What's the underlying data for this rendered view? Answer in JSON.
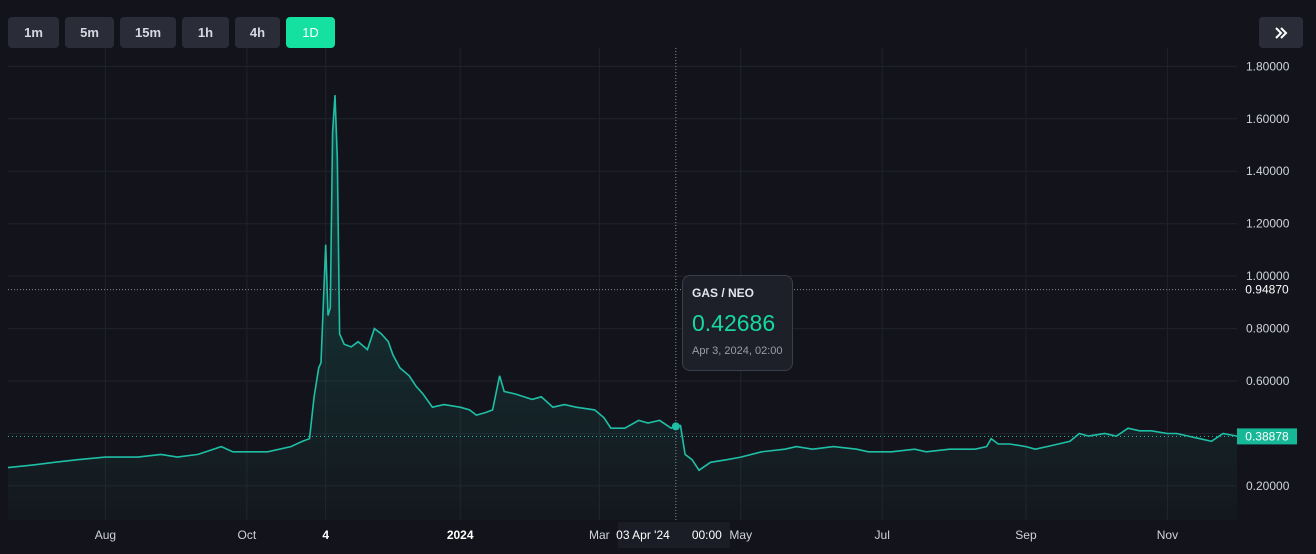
{
  "toolbar": {
    "timeframes": [
      "1m",
      "5m",
      "15m",
      "1h",
      "4h",
      "1D"
    ],
    "active": "1D"
  },
  "tooltip": {
    "pair": "GAS / NEO",
    "price": "0.42686",
    "date": "Apr 3, 2024, 02:00"
  },
  "crosshair": {
    "x_label": "03 Apr '24",
    "x_time": "00:00",
    "y_label": "0.94870"
  },
  "colors": {
    "line": "#1fbfa6",
    "accent": "#14e0a0",
    "background": "#13141b"
  },
  "chart_data": {
    "type": "area",
    "pair": "GAS / NEO",
    "last_value": 0.38878,
    "y_ticks": [
      "0.20000",
      "0.40000",
      "0.60000",
      "0.80000",
      "1.00000",
      "1.20000",
      "1.40000",
      "1.60000",
      "1.80000"
    ],
    "x_ticks": [
      {
        "label": "Aug",
        "date": "2023-08-01"
      },
      {
        "label": "Oct",
        "date": "2023-10-01"
      },
      {
        "label": "4",
        "date": "2023-11-04"
      },
      {
        "label": "2024",
        "date": "2024-01-01"
      },
      {
        "label": "Mar",
        "date": "2024-03-01"
      },
      {
        "label": "May",
        "date": "2024-05-01"
      },
      {
        "label": "Jul",
        "date": "2024-07-01"
      },
      {
        "label": "Sep",
        "date": "2024-09-01"
      },
      {
        "label": "Nov",
        "date": "2024-11-01"
      }
    ],
    "ylim": [
      0.07,
      1.87
    ],
    "xlim": [
      "2023-06-20",
      "2024-12-01"
    ],
    "series": [
      {
        "points": [
          [
            "2023-06-20",
            0.27
          ],
          [
            "2023-07-01",
            0.28
          ],
          [
            "2023-07-10",
            0.29
          ],
          [
            "2023-07-20",
            0.3
          ],
          [
            "2023-08-01",
            0.31
          ],
          [
            "2023-08-15",
            0.31
          ],
          [
            "2023-08-25",
            0.32
          ],
          [
            "2023-09-01",
            0.31
          ],
          [
            "2023-09-10",
            0.32
          ],
          [
            "2023-09-20",
            0.35
          ],
          [
            "2023-09-25",
            0.33
          ],
          [
            "2023-10-01",
            0.33
          ],
          [
            "2023-10-10",
            0.33
          ],
          [
            "2023-10-20",
            0.35
          ],
          [
            "2023-10-25",
            0.37
          ],
          [
            "2023-10-28",
            0.38
          ],
          [
            "2023-10-30",
            0.54
          ],
          [
            "2023-11-01",
            0.65
          ],
          [
            "2023-11-02",
            0.67
          ],
          [
            "2023-11-03",
            0.9
          ],
          [
            "2023-11-04",
            1.12
          ],
          [
            "2023-11-05",
            0.85
          ],
          [
            "2023-11-06",
            0.88
          ],
          [
            "2023-11-07",
            1.55
          ],
          [
            "2023-11-08",
            1.69
          ],
          [
            "2023-11-09",
            1.45
          ],
          [
            "2023-11-10",
            0.78
          ],
          [
            "2023-11-12",
            0.74
          ],
          [
            "2023-11-15",
            0.73
          ],
          [
            "2023-11-18",
            0.75
          ],
          [
            "2023-11-22",
            0.72
          ],
          [
            "2023-11-25",
            0.8
          ],
          [
            "2023-11-28",
            0.78
          ],
          [
            "2023-12-01",
            0.75
          ],
          [
            "2023-12-03",
            0.7
          ],
          [
            "2023-12-06",
            0.65
          ],
          [
            "2023-12-10",
            0.62
          ],
          [
            "2023-12-13",
            0.58
          ],
          [
            "2023-12-16",
            0.55
          ],
          [
            "2023-12-20",
            0.5
          ],
          [
            "2023-12-25",
            0.51
          ],
          [
            "2024-01-01",
            0.5
          ],
          [
            "2024-01-05",
            0.49
          ],
          [
            "2024-01-08",
            0.47
          ],
          [
            "2024-01-12",
            0.48
          ],
          [
            "2024-01-15",
            0.49
          ],
          [
            "2024-01-18",
            0.62
          ],
          [
            "2024-01-20",
            0.56
          ],
          [
            "2024-01-25",
            0.55
          ],
          [
            "2024-02-01",
            0.53
          ],
          [
            "2024-02-05",
            0.54
          ],
          [
            "2024-02-10",
            0.5
          ],
          [
            "2024-02-15",
            0.51
          ],
          [
            "2024-02-20",
            0.5
          ],
          [
            "2024-02-28",
            0.49
          ],
          [
            "2024-03-03",
            0.46
          ],
          [
            "2024-03-06",
            0.42
          ],
          [
            "2024-03-12",
            0.42
          ],
          [
            "2024-03-18",
            0.45
          ],
          [
            "2024-03-22",
            0.44
          ],
          [
            "2024-03-27",
            0.45
          ],
          [
            "2024-04-01",
            0.42
          ],
          [
            "2024-04-03",
            0.43
          ],
          [
            "2024-04-05",
            0.43
          ],
          [
            "2024-04-07",
            0.32
          ],
          [
            "2024-04-10",
            0.3
          ],
          [
            "2024-04-13",
            0.26
          ],
          [
            "2024-04-18",
            0.29
          ],
          [
            "2024-04-25",
            0.3
          ],
          [
            "2024-05-01",
            0.31
          ],
          [
            "2024-05-10",
            0.33
          ],
          [
            "2024-05-20",
            0.34
          ],
          [
            "2024-05-25",
            0.35
          ],
          [
            "2024-06-01",
            0.34
          ],
          [
            "2024-06-10",
            0.35
          ],
          [
            "2024-06-20",
            0.34
          ],
          [
            "2024-06-25",
            0.33
          ],
          [
            "2024-07-05",
            0.33
          ],
          [
            "2024-07-15",
            0.34
          ],
          [
            "2024-07-20",
            0.33
          ],
          [
            "2024-07-30",
            0.34
          ],
          [
            "2024-08-10",
            0.34
          ],
          [
            "2024-08-15",
            0.35
          ],
          [
            "2024-08-17",
            0.38
          ],
          [
            "2024-08-20",
            0.36
          ],
          [
            "2024-08-25",
            0.36
          ],
          [
            "2024-09-01",
            0.35
          ],
          [
            "2024-09-05",
            0.34
          ],
          [
            "2024-09-10",
            0.35
          ],
          [
            "2024-09-15",
            0.36
          ],
          [
            "2024-09-20",
            0.37
          ],
          [
            "2024-09-24",
            0.4
          ],
          [
            "2024-09-28",
            0.39
          ],
          [
            "2024-10-05",
            0.4
          ],
          [
            "2024-10-10",
            0.39
          ],
          [
            "2024-10-15",
            0.42
          ],
          [
            "2024-10-20",
            0.41
          ],
          [
            "2024-10-25",
            0.41
          ],
          [
            "2024-11-01",
            0.4
          ],
          [
            "2024-11-05",
            0.4
          ],
          [
            "2024-11-10",
            0.39
          ],
          [
            "2024-11-15",
            0.38
          ],
          [
            "2024-11-20",
            0.37
          ],
          [
            "2024-11-25",
            0.4
          ],
          [
            "2024-12-01",
            0.39
          ]
        ]
      }
    ],
    "crosshair": {
      "date": "2024-04-03",
      "value": 0.42686,
      "y_value": 0.9487
    }
  }
}
